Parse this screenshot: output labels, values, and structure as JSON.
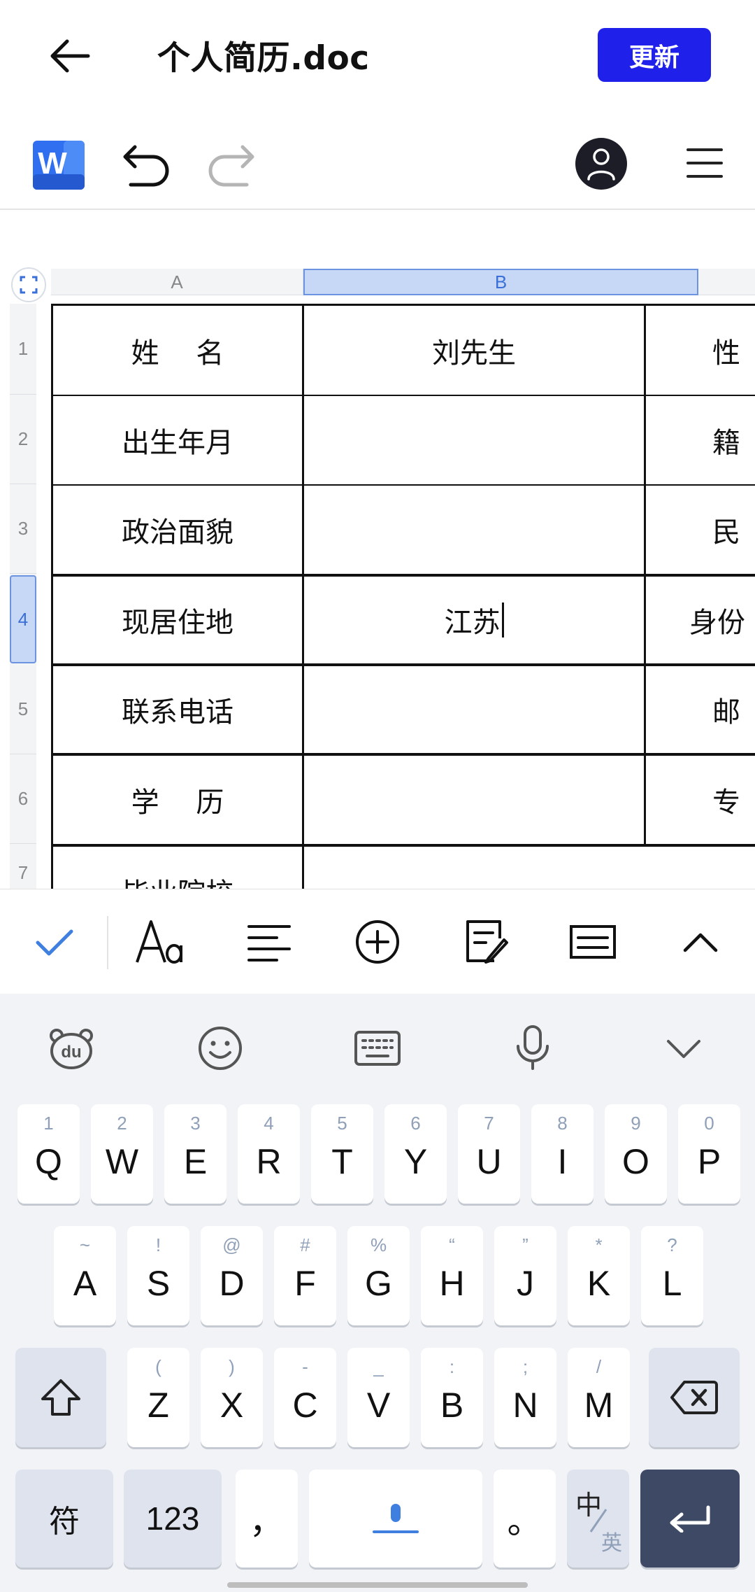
{
  "header": {
    "title": "个人简历.doc",
    "update_label": "更新"
  },
  "toolbar": {
    "logo_letter": "W"
  },
  "sheet": {
    "columns": [
      "A",
      "B"
    ],
    "rows": [
      "1",
      "2",
      "3",
      "4",
      "5",
      "6",
      "7"
    ],
    "selected_column": "B",
    "selected_row": "4",
    "cells": {
      "r1": [
        "姓　 名",
        "刘先生",
        "性"
      ],
      "r2": [
        "出生年月",
        "",
        "籍"
      ],
      "r3": [
        "政治面貌",
        "",
        "民"
      ],
      "r4": [
        "现居住地",
        "江苏",
        "身份"
      ],
      "r5": [
        "联系电话",
        "",
        "邮"
      ],
      "r6": [
        "学　 历",
        "",
        "专"
      ],
      "r7": [
        "毕业院校",
        "",
        ""
      ]
    }
  },
  "keyboard": {
    "row1": [
      {
        "hint": "1",
        "label": "Q"
      },
      {
        "hint": "2",
        "label": "W"
      },
      {
        "hint": "3",
        "label": "E"
      },
      {
        "hint": "4",
        "label": "R"
      },
      {
        "hint": "5",
        "label": "T"
      },
      {
        "hint": "6",
        "label": "Y"
      },
      {
        "hint": "7",
        "label": "U"
      },
      {
        "hint": "8",
        "label": "I"
      },
      {
        "hint": "9",
        "label": "O"
      },
      {
        "hint": "0",
        "label": "P"
      }
    ],
    "row2": [
      {
        "hint": "~",
        "label": "A"
      },
      {
        "hint": "!",
        "label": "S"
      },
      {
        "hint": "@",
        "label": "D"
      },
      {
        "hint": "#",
        "label": "F"
      },
      {
        "hint": "%",
        "label": "G"
      },
      {
        "hint": "“",
        "label": "H"
      },
      {
        "hint": "”",
        "label": "J"
      },
      {
        "hint": "*",
        "label": "K"
      },
      {
        "hint": "?",
        "label": "L"
      }
    ],
    "row3": [
      {
        "hint": "(",
        "label": "Z"
      },
      {
        "hint": ")",
        "label": "X"
      },
      {
        "hint": "-",
        "label": "C"
      },
      {
        "hint": "_",
        "label": "V"
      },
      {
        "hint": ":",
        "label": "B"
      },
      {
        "hint": ";",
        "label": "N"
      },
      {
        "hint": "/",
        "label": "M"
      }
    ],
    "symbols_label": "符",
    "numbers_label": "123",
    "comma_label": "，",
    "period_label": "。",
    "lang_top": "中",
    "lang_bottom": "英"
  },
  "colors": {
    "accent": "#1f21ea",
    "selection": "#c7d7f6",
    "check": "#3f7fe0"
  }
}
